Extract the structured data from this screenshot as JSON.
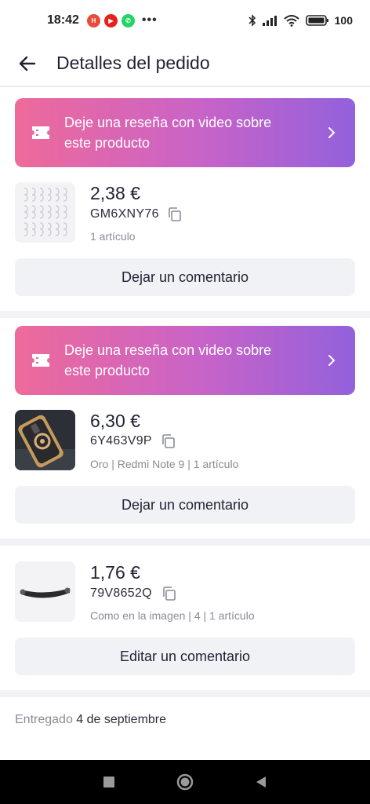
{
  "status_bar": {
    "time": "18:42",
    "battery_text": "100",
    "apps": [
      {
        "name": "hm-app",
        "color": "#e84b3c",
        "glyph": "H"
      },
      {
        "name": "youtube-app",
        "color": "#e62117",
        "glyph": "▶"
      },
      {
        "name": "whatsapp-app",
        "color": "#25d366",
        "glyph": "✆"
      }
    ],
    "more": "•••"
  },
  "header": {
    "title": "Detalles del pedido",
    "back_icon": "arrow-left-icon"
  },
  "orders": [
    {
      "banner_text": "Deje una reseña con video sobre este producto",
      "price": "2,38 €",
      "order_id": "GM6XNY76",
      "meta": "1 artículo",
      "button": "Dejar un comentario",
      "thumb": "hooks-image"
    },
    {
      "banner_text": "Deje una reseña con video sobre este producto",
      "price": "6,30 €",
      "order_id": "6Y463V9P",
      "meta": "Oro | Redmi Note 9 | 1 artículo",
      "button": "Dejar un comentario",
      "thumb": "phone-case-image"
    },
    {
      "price": "1,76 €",
      "order_id": "79V8652Q",
      "meta": "Como en la imagen | 4 | 1 artículo",
      "button": "Editar un comentario",
      "thumb": "handle-image"
    }
  ],
  "delivery": {
    "label": "Entregado",
    "date": "4 de septiembre"
  },
  "colors": {
    "banner_start": "#ee6a9a",
    "banner_end": "#9261dc",
    "button_bg": "#f1f2f5"
  }
}
